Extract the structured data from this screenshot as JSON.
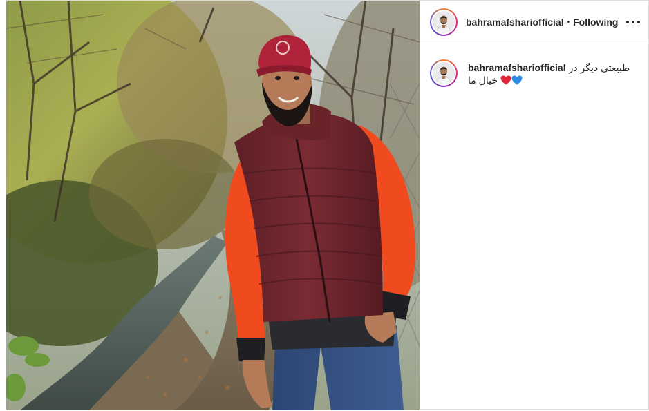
{
  "post": {
    "username": "bahramafshariofficial",
    "separator": "•",
    "follow_status": "Following",
    "more_icon": "more-horizontal-icon"
  },
  "caption": {
    "username": "bahramafshariofficial",
    "text_line1": "طبیعتی دیگر در",
    "text_line2": "خیال ما",
    "emojis": [
      "blue-heart-icon",
      "red-heart-icon"
    ]
  },
  "media": {
    "alt": "Man in a red cap and maroon puffer vest standing beside a stream on an autumn forest path"
  },
  "colors": {
    "blue_heart": "#2b8be6",
    "red_heart": "#e0223a",
    "border": "#dbdbdb"
  }
}
